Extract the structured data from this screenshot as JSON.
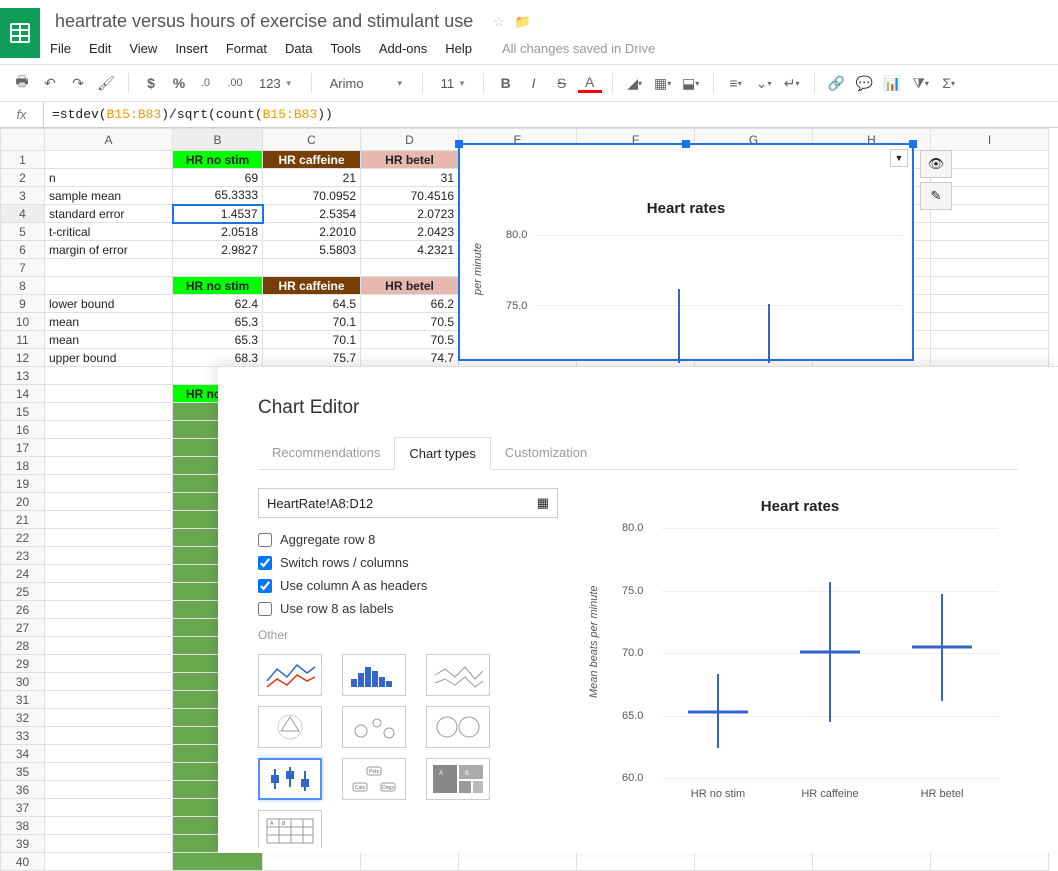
{
  "doc_title": "heartrate versus hours of exercise and stimulant use",
  "menu": [
    "File",
    "Edit",
    "View",
    "Insert",
    "Format",
    "Data",
    "Tools",
    "Add-ons",
    "Help"
  ],
  "save_status": "All changes saved in Drive",
  "toolbar": {
    "font": "Arimo",
    "font_size": "11"
  },
  "formula": {
    "prefix": "=stdev(",
    "ref1": "B15:B83",
    "mid": ")/sqrt(count(",
    "ref2": "B15:B83",
    "suffix": "))"
  },
  "columns": [
    "A",
    "B",
    "C",
    "D",
    "E",
    "F",
    "G",
    "H",
    "I"
  ],
  "headers1": {
    "b": "HR no stim",
    "c": "HR caffeine",
    "d": "HR betel"
  },
  "rows": [
    {
      "label": "n",
      "b": "69",
      "c": "21",
      "d": "31"
    },
    {
      "label": "sample mean",
      "b": "65.3333",
      "c": "70.0952",
      "d": "70.4516"
    },
    {
      "label": "standard error",
      "b": "1.4537",
      "c": "2.5354",
      "d": "2.0723"
    },
    {
      "label": "t-critical",
      "b": "2.0518",
      "c": "2.2010",
      "d": "2.0423"
    },
    {
      "label": "margin of error",
      "b": "2.9827",
      "c": "5.5803",
      "d": "4.2321"
    }
  ],
  "headers2": {
    "b": "HR no stim",
    "c": "HR caffeine",
    "d": "HR betel"
  },
  "rows2": [
    {
      "label": "lower bound",
      "b": "62.4",
      "c": "64.5",
      "d": "66.2"
    },
    {
      "label": "mean",
      "b": "65.3",
      "c": "70.1",
      "d": "70.5"
    },
    {
      "label": "mean",
      "b": "65.3",
      "c": "70.1",
      "d": "70.5"
    },
    {
      "label": "upper bound",
      "b": "68.3",
      "c": "75.7",
      "d": "74.7"
    }
  ],
  "row14_b": "HR no stim",
  "chart": {
    "title": "Heart rates",
    "ylabel": "per minute",
    "ticks": [
      "80.0",
      "75.0"
    ]
  },
  "editor": {
    "title": "Chart Editor",
    "tabs": [
      "Recommendations",
      "Chart types",
      "Customization"
    ],
    "range": "HeartRate!A8:D12",
    "opts": {
      "aggregate": "Aggregate row 8",
      "switch": "Switch rows / columns",
      "useColA": "Use column A as headers",
      "useRow8": "Use row 8 as labels"
    },
    "section": "Other"
  },
  "chart_data": {
    "type": "candlestick",
    "title": "Heart rates",
    "ylabel": "Mean beats per minute",
    "ylim": [
      60,
      80
    ],
    "yticks": [
      60.0,
      65.0,
      70.0,
      75.0,
      80.0
    ],
    "categories": [
      "HR no stim",
      "HR caffeine",
      "HR betel"
    ],
    "series": [
      {
        "name": "HR no stim",
        "low": 62.4,
        "open": 65.3,
        "close": 65.3,
        "high": 68.3
      },
      {
        "name": "HR caffeine",
        "low": 64.5,
        "open": 70.1,
        "close": 70.1,
        "high": 75.7
      },
      {
        "name": "HR betel",
        "low": 66.2,
        "open": 70.5,
        "close": 70.5,
        "high": 74.7
      }
    ]
  }
}
